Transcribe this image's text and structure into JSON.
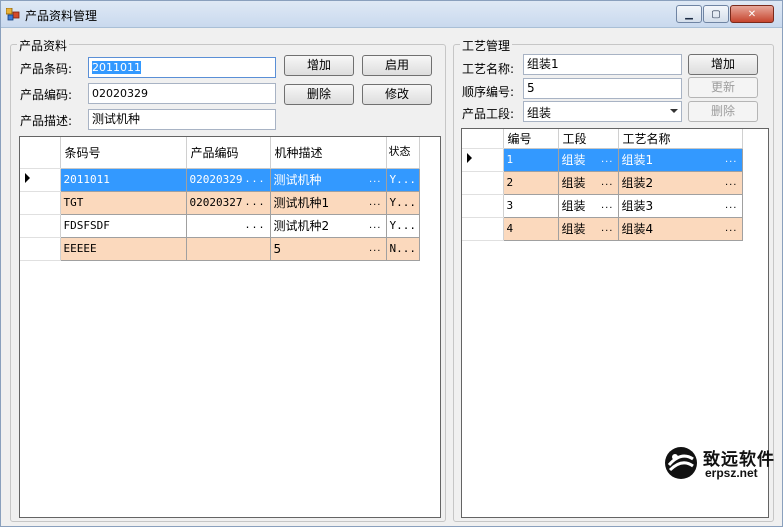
{
  "window": {
    "title": "产品资料管理",
    "min_label": "▁",
    "max_label": "▢",
    "close_label": "✕"
  },
  "product": {
    "group_title": "产品资料",
    "barcode_label": "产品条码:",
    "barcode_value": "2011011",
    "code_label": "产品编码:",
    "code_value": "02020329",
    "desc_label": "产品描述:",
    "desc_value": "测试机种",
    "buttons": {
      "add": "增加",
      "enable": "启用",
      "delete": "删除",
      "edit": "修改"
    },
    "grid": {
      "columns": [
        "条码号",
        "产品编码",
        "机种描述",
        "状态"
      ],
      "rows": [
        {
          "barcode": "2011011",
          "code": "02020329",
          "desc": "测试机种",
          "status": "Y..."
        },
        {
          "barcode": "TGT",
          "code": "02020327",
          "desc": "测试机种1",
          "status": "Y..."
        },
        {
          "barcode": "FDSFSDF",
          "code": "",
          "desc": "测试机种2",
          "status": "Y..."
        },
        {
          "barcode": "EEEEE",
          "code": "",
          "desc": "5",
          "status": "N..."
        }
      ]
    }
  },
  "process": {
    "group_title": "工艺管理",
    "name_label": "工艺名称:",
    "name_value": "组装1",
    "seq_label": "顺序编号:",
    "seq_value": "5",
    "stage_label": "产品工段:",
    "stage_value": "组装",
    "buttons": {
      "add": "增加",
      "update": "更新",
      "delete": "删除"
    },
    "grid": {
      "columns": [
        "编号",
        "工段",
        "工艺名称"
      ],
      "rows": [
        {
          "id": "1",
          "stage": "组装",
          "name": "组装1"
        },
        {
          "id": "2",
          "stage": "组装",
          "name": "组装2"
        },
        {
          "id": "3",
          "stage": "组装",
          "name": "组装3"
        },
        {
          "id": "4",
          "stage": "组装",
          "name": "组装4"
        }
      ]
    }
  },
  "watermark": {
    "name": "致远软件",
    "url": "erpsz.net"
  },
  "colors": {
    "selection": "#3399ff",
    "alt_row": "#fbd9bd"
  }
}
